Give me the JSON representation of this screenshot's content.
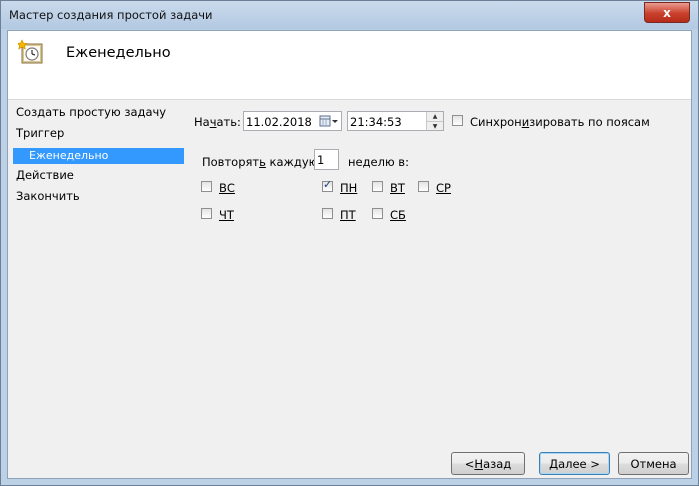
{
  "window": {
    "title": "Мастер создания простой задачи",
    "close_glyph": "x"
  },
  "header": {
    "title": "Еженедельно",
    "icon": "task-scheduler-clock-icon"
  },
  "nav": {
    "items": [
      {
        "label": "Создать простую задачу"
      },
      {
        "label": "Триггер"
      },
      {
        "label": "Еженедельно",
        "selected": true
      },
      {
        "label": "Действие"
      },
      {
        "label": "Закончить"
      }
    ]
  },
  "start": {
    "label_prefix": "На",
    "label_accel": "ч",
    "label_suffix": "ать:",
    "date_value": "11.02.2018",
    "time_value": "21:34:53",
    "sync_prefix": "Синхрон",
    "sync_accel": "и",
    "sync_suffix": "зировать по поясам",
    "sync_checked": false
  },
  "repeat": {
    "label_prefix": "Повторят",
    "label_accel": "ь",
    "label_suffix": " каждую",
    "value": "1",
    "suffix": "неделю в:"
  },
  "days": {
    "sun": {
      "label": "ВС",
      "checked": false
    },
    "mon": {
      "label": "ПН",
      "checked": true
    },
    "tue": {
      "label": "ВТ",
      "checked": false
    },
    "wed": {
      "label": "СР",
      "checked": false
    },
    "thu": {
      "label": "ЧТ",
      "checked": false
    },
    "fri": {
      "label": "ПТ",
      "checked": false
    },
    "sat": {
      "label": "СБ",
      "checked": false
    }
  },
  "buttons": {
    "back_prefix": "< ",
    "back_accel": "Н",
    "back_suffix": "азад",
    "next_prefix": "",
    "next_accel": "Д",
    "next_suffix": "алее >",
    "cancel": "Отмена"
  },
  "colors": {
    "selection": "#3399ff",
    "titlebar": "#bcd0e6",
    "close": "#c9402c"
  }
}
